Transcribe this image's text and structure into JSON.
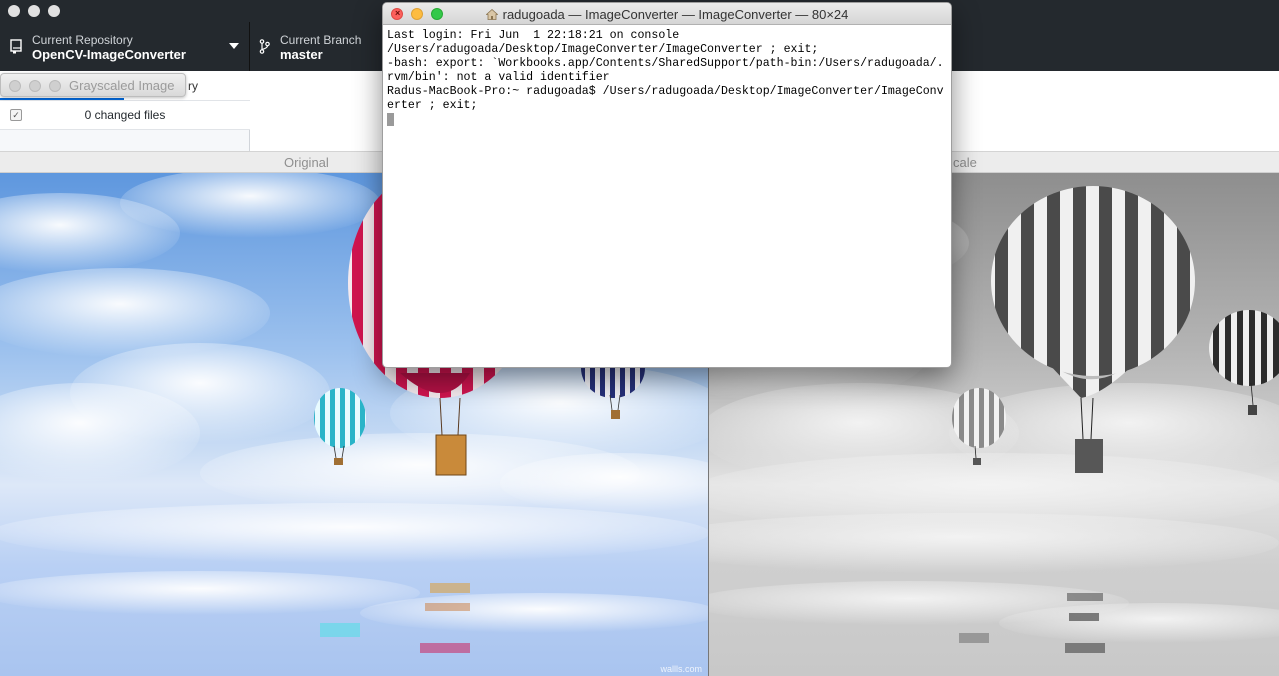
{
  "github": {
    "repo_caption": "Current Repository",
    "repo_name": "OpenCV-ImageConverter",
    "branch_caption": "Current Branch",
    "branch_name": "master",
    "tab_history_partial": "ry",
    "changed_files": "0 changed files"
  },
  "grayscaled_window": {
    "title": "Grayscaled Image"
  },
  "viewer": {
    "left_label": "Original",
    "right_label_partial": "cale",
    "watermark": "wallls.com"
  },
  "terminal": {
    "title": "radugoada — ImageConverter — ImageConverter — 80×24",
    "lines": [
      "Last login: Fri Jun  1 22:18:21 on console",
      "/Users/radugoada/Desktop/ImageConverter/ImageConverter ; exit;",
      "-bash: export: `Workbooks.app/Contents/SharedSupport/path-bin:/Users/radugoada/.",
      "rvm/bin': not a valid identifier",
      "Radus-MacBook-Pro:~ radugoada$ /Users/radugoada/Desktop/ImageConverter/ImageConv",
      "erter ; exit;"
    ]
  },
  "colors": {
    "toolbar_bg": "#24292e",
    "close": "#fc605c",
    "minimize": "#fdbc40",
    "maximize": "#34c84a"
  }
}
